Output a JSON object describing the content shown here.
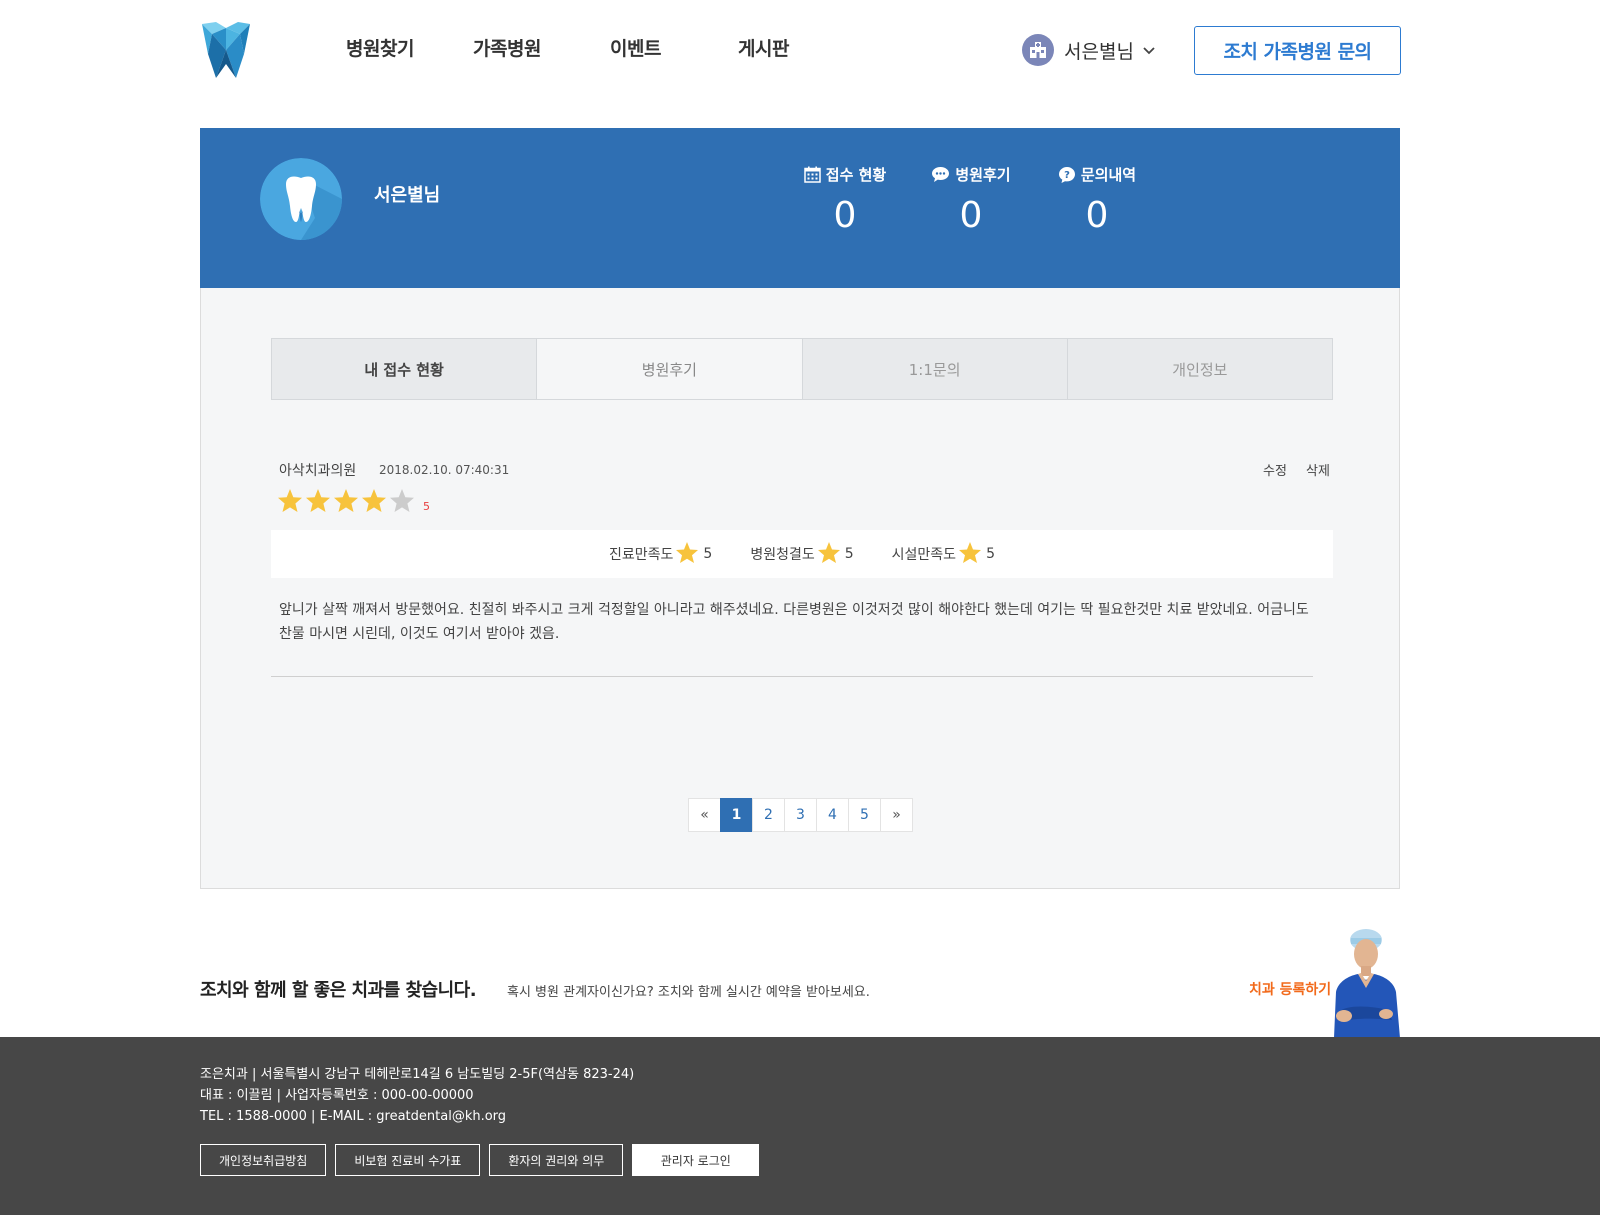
{
  "nav": {
    "items": [
      "병원찾기",
      "가족병원",
      "이벤트",
      "게시판"
    ]
  },
  "user": {
    "name": "서은별님"
  },
  "header": {
    "inquiry_label": "조치 가족병원 문의"
  },
  "profile": {
    "name": "서은별님",
    "stats": [
      {
        "label": "접수 현황",
        "value": "0",
        "icon": "calendar-icon"
      },
      {
        "label": "병원후기",
        "value": "0",
        "icon": "speech-bubble-icon"
      },
      {
        "label": "문의내역",
        "value": "0",
        "icon": "question-bubble-icon"
      }
    ]
  },
  "tabs": [
    "내 접수 현황",
    "병원후기",
    "1:1문의",
    "개인정보"
  ],
  "active_tab": "병원후기",
  "review": {
    "hospital": "아삭치과의원",
    "date": "2018.02.10. 07:40:31",
    "edit_label": "수정",
    "delete_label": "삭제",
    "stars_filled": 4,
    "stars_total": 5,
    "score": "5",
    "subratings": [
      {
        "label": "진료만족도",
        "value": "5"
      },
      {
        "label": "병원청결도",
        "value": "5"
      },
      {
        "label": "시설만족도",
        "value": "5"
      }
    ],
    "text": "앞니가 살짝 깨져서 방문했어요. 친절히 봐주시고 크게 걱정할일 아니라고 해주셨네요. 다른병원은 이것저것 많이 해야한다 했는데 여기는 딱 필요한것만 치료 받았네요. 어금니도 찬물 마시면 시린데, 이것도 여기서 받아야 겠음."
  },
  "pagination": {
    "prev": "«",
    "pages": [
      "1",
      "2",
      "3",
      "4",
      "5"
    ],
    "current": "1",
    "next": "»"
  },
  "promo": {
    "title": "조치와 함께 할 좋은 치과를 찾습니다.",
    "subtitle": "혹시 병원 관계자이신가요?  조치와 함께 실시간 예약을 받아보세요.",
    "link": "치과 등록하기"
  },
  "footer": {
    "line1": "조은치과 | 서울특별시 강남구 테헤란로14길 6 남도빌딩 2-5F(역삼동 823-24)",
    "line2": "대표 : 이끌림 | 사업자등록번호 : 000-00-00000",
    "line3": "TEL : 1588-0000 | E-MAIL : greatdental@kh.org",
    "buttons": [
      "개인정보취급방침",
      "비보험 진료비 수가표",
      "환자의 권리와 의무"
    ],
    "admin_label": "관리자 로그인"
  },
  "colors": {
    "brand_blue": "#2f6fb3",
    "accent_orange": "#f26a1b",
    "star_gold": "#f7c33c",
    "footer_bg": "#474747"
  }
}
